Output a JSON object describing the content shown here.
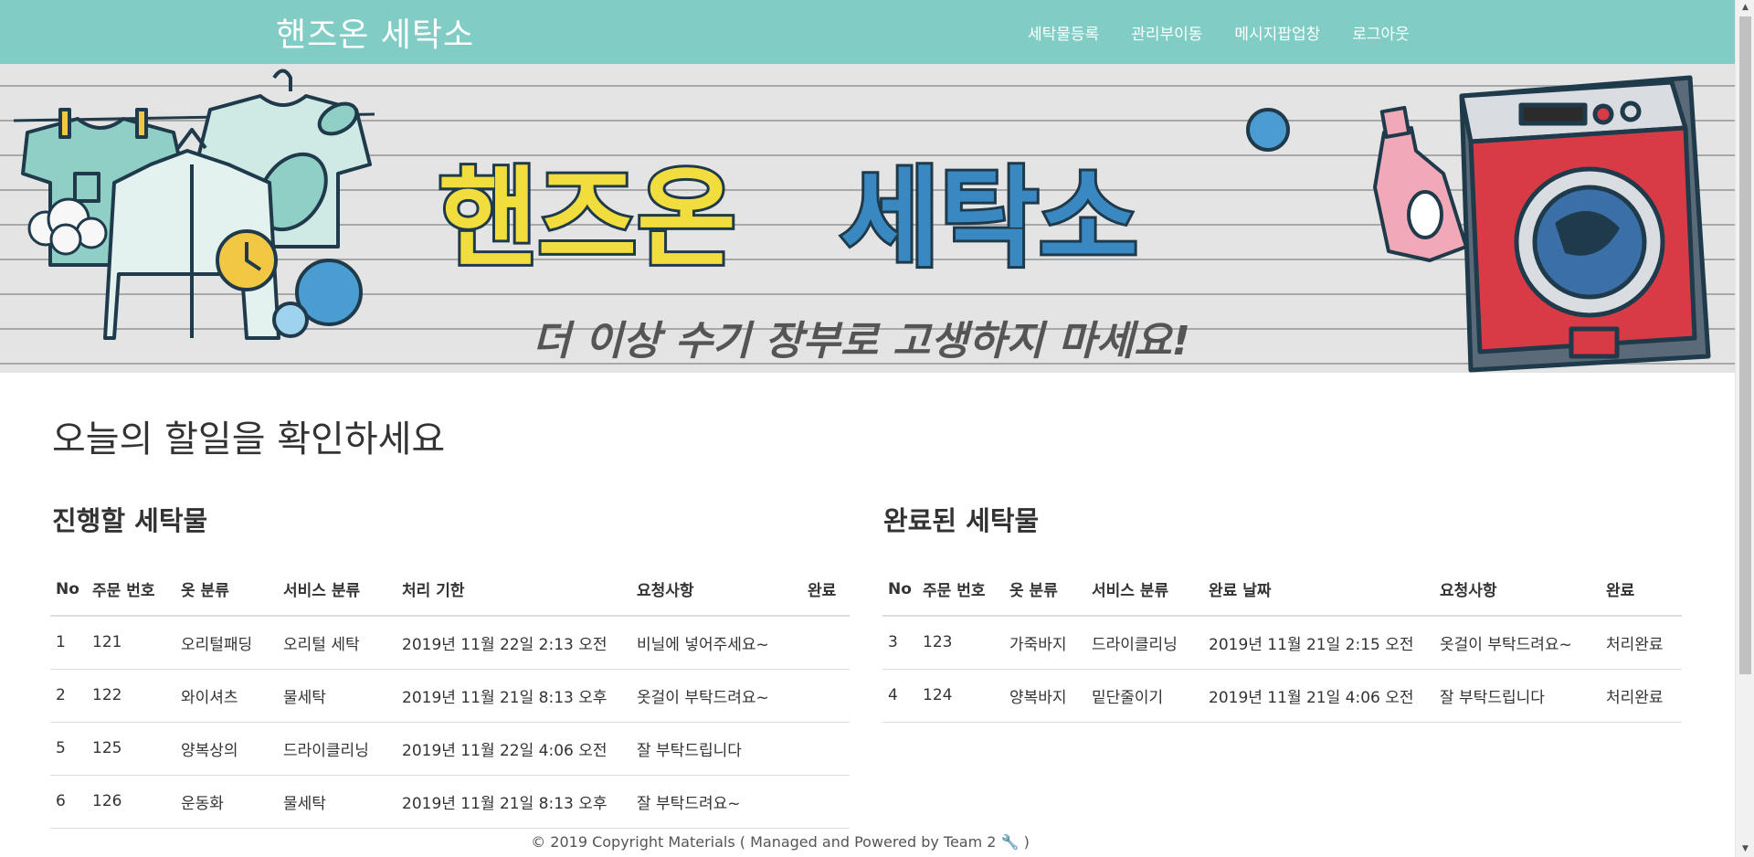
{
  "navbar": {
    "brand": "핸즈온 세탁소",
    "links": [
      "세탁물등록",
      "관리부이동",
      "메시지팝업창",
      "로그아웃"
    ],
    "bg_color": "#81cdc6"
  },
  "banner": {
    "title_part1": "핸즈온",
    "title_part2": "세탁소",
    "subtitle": "더 이상 수기 장부로 고생하지 마세요!"
  },
  "main": {
    "title": "오늘의 할일을 확인하세요",
    "pending": {
      "title": "진행할 세탁물",
      "headers": [
        "No",
        "주문 번호",
        "옷 분류",
        "서비스 분류",
        "처리 기한",
        "요청사항",
        "완료"
      ],
      "rows": [
        [
          "1",
          "121",
          "오리털패딩",
          "오리털 세탁",
          "2019년 11월 22일 2:13 오전",
          "비닐에 넣어주세요~",
          ""
        ],
        [
          "2",
          "122",
          "와이셔츠",
          "물세탁",
          "2019년 11월 21일 8:13 오후",
          "옷걸이 부탁드려요~",
          ""
        ],
        [
          "5",
          "125",
          "양복상의",
          "드라이클리닝",
          "2019년 11월 22일 4:06 오전",
          "잘 부탁드립니다",
          ""
        ],
        [
          "6",
          "126",
          "운동화",
          "물세탁",
          "2019년 11월 21일 8:13 오후",
          "잘 부탁드려요~",
          ""
        ]
      ]
    },
    "completed": {
      "title": "완료된 세탁물",
      "headers": [
        "No",
        "주문 번호",
        "옷 분류",
        "서비스 분류",
        "완료 날짜",
        "요청사항",
        "완료"
      ],
      "rows": [
        [
          "3",
          "123",
          "가죽바지",
          "드라이클리닝",
          "2019년 11월 21일 2:15 오전",
          "옷걸이 부탁드려요~",
          "처리완료"
        ],
        [
          "4",
          "124",
          "양복바지",
          "밑단줄이기",
          "2019년 11월 21일 4:06 오전",
          "잘 부탁드립니다",
          "처리완료"
        ]
      ]
    }
  },
  "footer": {
    "text": "© 2019 Copyright Materials ( Managed and Powered by Team 2",
    "icon_glyph": "🔧",
    "icon": "wrench-icon",
    "close": ")"
  }
}
